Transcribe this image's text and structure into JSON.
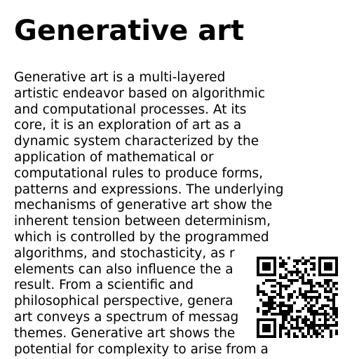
{
  "document": {
    "title": "Generative art",
    "lines": [
      "Generative art is a multi-layered",
      "artistic endeavor based on algorithmic",
      "and computational processes. At its",
      "core, it is an exploration of art as a",
      "dynamic system characterized by the",
      "application of mathematical or",
      "computational rules to produce forms,",
      "patterns and expressions. The underlying",
      "mechanisms of generative art show the",
      "inherent tension between determinism,",
      "which is controlled by the programmed",
      "algorithms, and stochasticity, as r",
      "elements can also influence the a",
      "result. From a scientific and",
      "philosophical perspective, genera",
      "art conveys a spectrum of messag",
      "themes. Generative art shows the",
      "potential for complexity to arise from a"
    ]
  },
  "qr_code": {
    "icon": "qr-code-icon",
    "color": "#000000"
  }
}
